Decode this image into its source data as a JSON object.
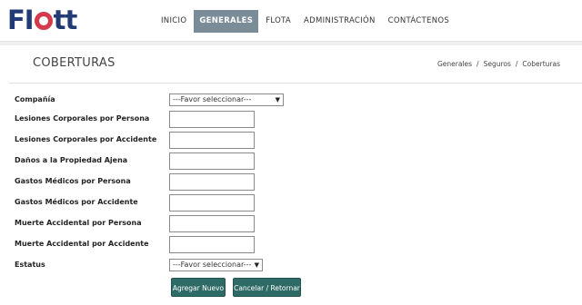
{
  "logo": {
    "part1": "FI",
    "part2": "tt"
  },
  "nav": [
    "INICIO",
    "GENERALES",
    "FLOTA",
    "ADMINISTRACIÓN",
    "CONTÁCTENOS"
  ],
  "page_title": "COBERTURAS",
  "breadcrumb": [
    "Generales",
    "/",
    "Seguros",
    "/",
    "Coberturas"
  ],
  "form": {
    "compania": {
      "label": "Compañía",
      "selected": "---Favor seleccionar---"
    },
    "fields": [
      "Lesiones Corporales por Persona",
      "Lesiones Corporales por Accidente",
      "Daños a la Propiedad Ajena",
      "Gastos Médicos por Persona",
      "Gastos Médicos por Accidente",
      "Muerte Accidental por Persona",
      "Muerte Accidental por Accidente"
    ],
    "estatus": {
      "label": "Estatus",
      "selected": "---Favor seleccionar---"
    }
  },
  "buttons": {
    "add": "Agregar Nuevo",
    "cancel": "Cancelar / Retornar"
  },
  "colors": {
    "brand_navy": "#233b74",
    "brand_red": "#d33b4a",
    "nav_active": "#7b8c99",
    "button": "#2f6b66"
  },
  "icons": {
    "dropdown": "triangle-down-icon"
  }
}
